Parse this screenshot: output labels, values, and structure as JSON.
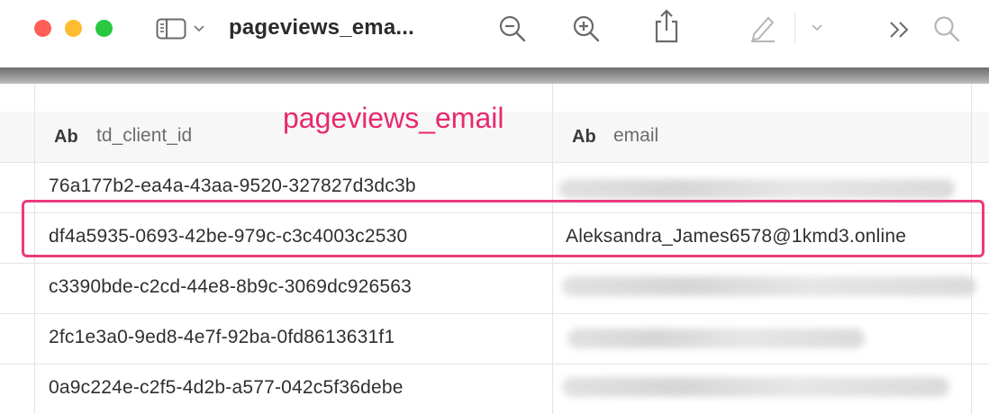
{
  "window": {
    "title": "pageviews_ema...",
    "buttons": [
      "close",
      "minimize",
      "zoom"
    ]
  },
  "toolbar": {
    "icons": [
      "sidebar-toggle-icon",
      "chevron-down-icon",
      "zoom-out-icon",
      "zoom-in-icon",
      "share-icon",
      "markup-pen-icon",
      "chevron-down-icon",
      "overflow-chevrons-icon",
      "search-icon"
    ]
  },
  "annotation": {
    "label": "pageviews_email",
    "color": "#e8296e"
  },
  "table": {
    "columns": [
      {
        "type_badge": "Ab",
        "name": "td_client_id"
      },
      {
        "type_badge": "Ab",
        "name": "email"
      }
    ],
    "rows": [
      {
        "td_client_id": "76a177b2-ea4a-43aa-9520-327827d3dc3b",
        "email": "",
        "email_blurred": true
      },
      {
        "td_client_id": "df4a5935-0693-42be-979c-c3c4003c2530",
        "email": "Aleksandra_James6578@1kmd3.online",
        "email_blurred": false,
        "highlighted": true
      },
      {
        "td_client_id": "c3390bde-c2cd-44e8-8b9c-3069dc926563",
        "email": "",
        "email_blurred": true
      },
      {
        "td_client_id": "2fc1e3a0-9ed8-4e7f-92ba-0fd8613631f1",
        "email": "",
        "email_blurred": true
      },
      {
        "td_client_id": "0a9c224e-c2f5-4d2b-a577-042c5f36debe",
        "email": "",
        "email_blurred": true
      }
    ]
  },
  "colors": {
    "highlight_border": "#ea3b7d",
    "traffic_red": "#fe5f57",
    "traffic_yellow": "#febc2e",
    "traffic_green": "#28c840"
  }
}
